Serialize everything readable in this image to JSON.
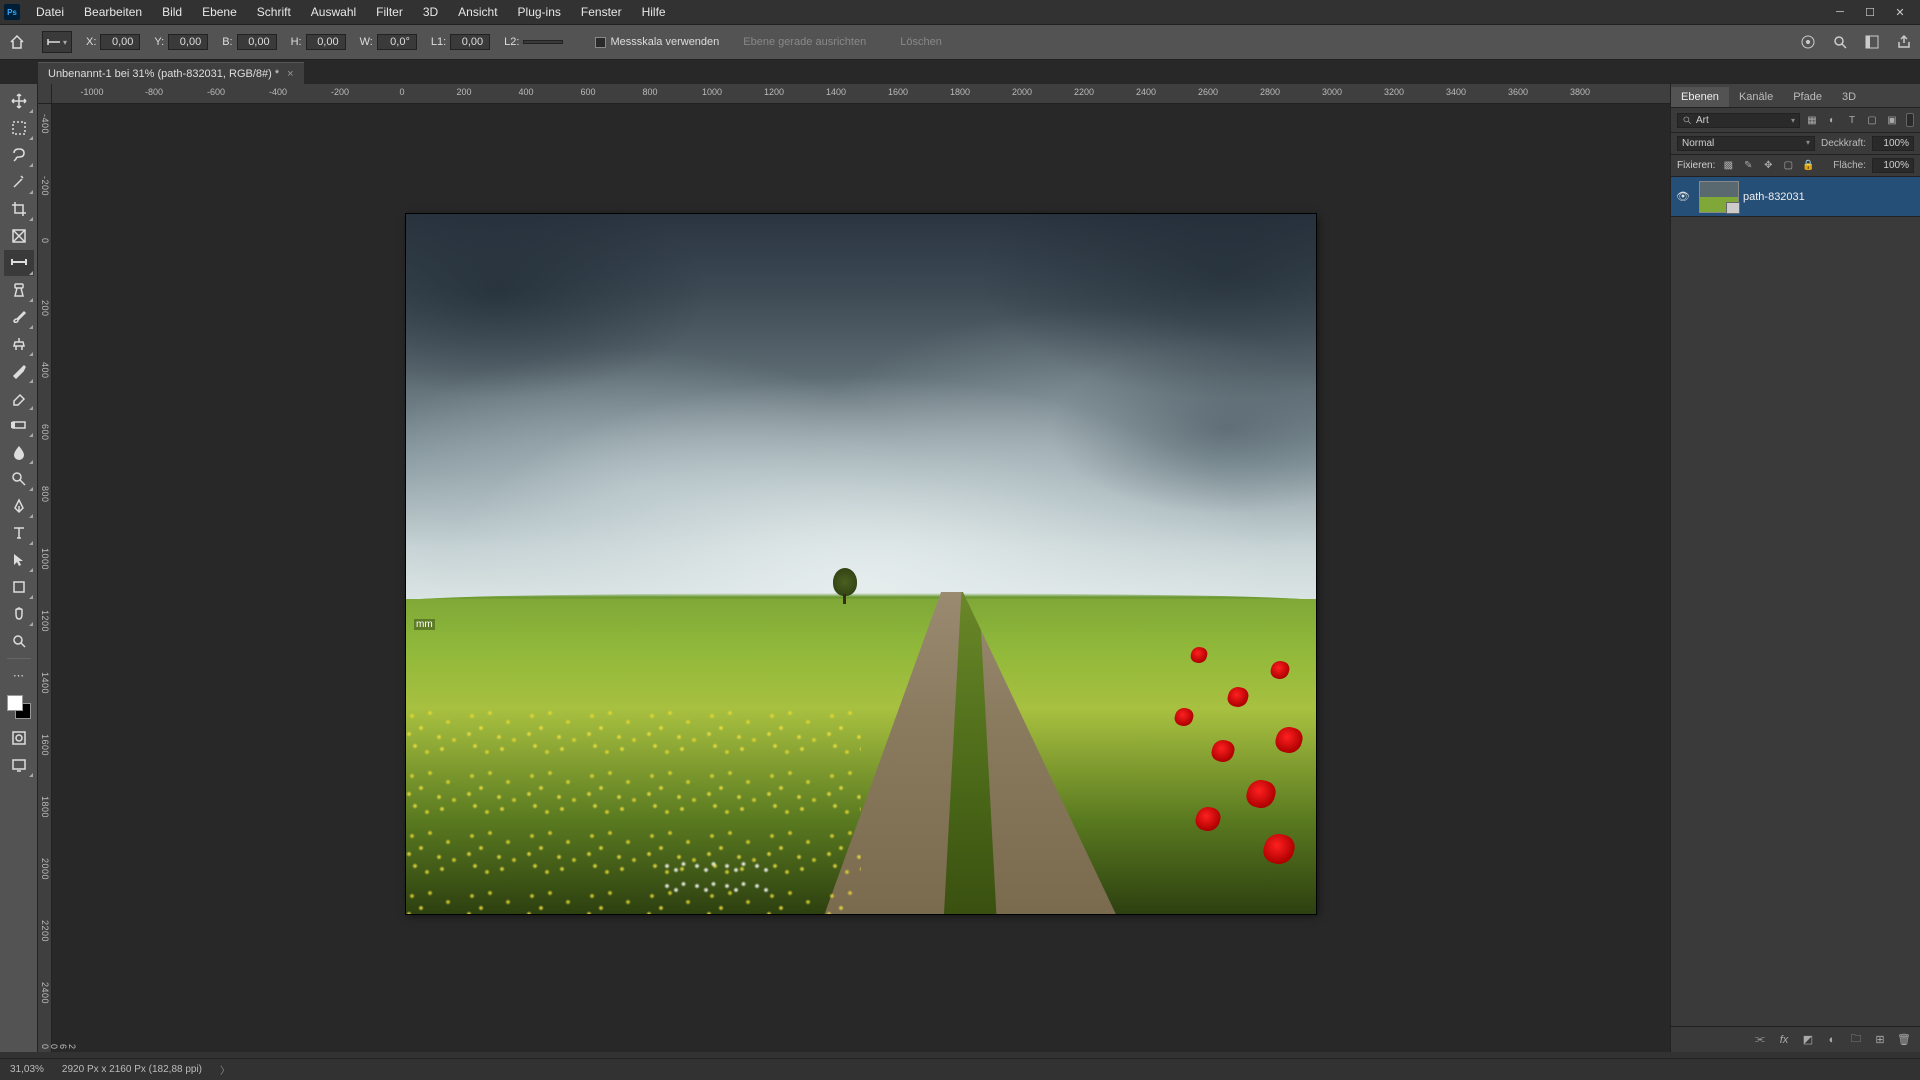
{
  "titlebar": {
    "app_abbrev": "Ps"
  },
  "menu": [
    "Datei",
    "Bearbeiten",
    "Bild",
    "Ebene",
    "Schrift",
    "Auswahl",
    "Filter",
    "3D",
    "Ansicht",
    "Plug-ins",
    "Fenster",
    "Hilfe"
  ],
  "options": {
    "x_label": "X:",
    "x_val": "0,00",
    "y_label": "Y:",
    "y_val": "0,00",
    "b_label": "B:",
    "b_val": "0,00",
    "h_label": "H:",
    "h_val": "0,00",
    "w_label": "W:",
    "w_val": "0,0°",
    "l1_label": "L1:",
    "l1_val": "0,00",
    "l2_label": "L2:",
    "l2_val": "",
    "chk_label": "Messskala verwenden",
    "btn_straighten": "Ebene gerade ausrichten",
    "btn_clear": "Löschen"
  },
  "doc_tab": {
    "title": "Unbenannt-1 bei 31% (path-832031, RGB/8#) *"
  },
  "ruler_h": [
    -1000,
    -800,
    -600,
    -400,
    -200,
    0,
    200,
    400,
    600,
    800,
    1000,
    1200,
    1400,
    1600,
    1800,
    2000,
    2200,
    2400,
    2600,
    2800,
    3000,
    3200,
    3400,
    3600,
    3800
  ],
  "ruler_v": [
    -400,
    -200,
    0,
    200,
    400,
    600,
    800,
    1000,
    1200,
    1400,
    1600,
    1800,
    2000,
    2200,
    2400,
    2600
  ],
  "cursor_badge": "mm",
  "panels": {
    "tabs": [
      "Ebenen",
      "Kanäle",
      "Pfade",
      "3D"
    ],
    "search_placeholder": "Art",
    "blend_mode": "Normal",
    "opacity_label": "Deckkraft:",
    "opacity_value": "100%",
    "lock_label": "Fixieren:",
    "fill_label": "Fläche:",
    "fill_value": "100%",
    "layer_name": "path-832031"
  },
  "status": {
    "zoom": "31,03%",
    "doc_info": "2920 Px x 2160 Px (182,88 ppi)"
  }
}
